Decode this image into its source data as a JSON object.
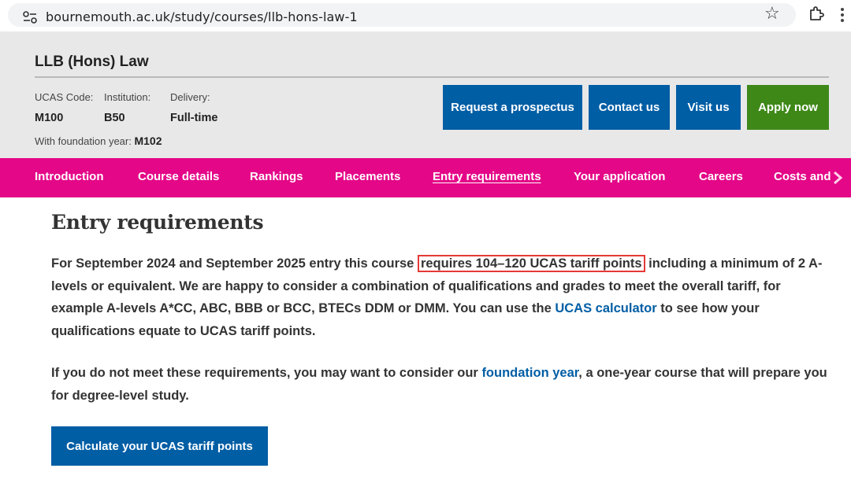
{
  "browser": {
    "url": "bournemouth.ac.uk/study/courses/llb-hons-law-1"
  },
  "course": {
    "title": "LLB (Hons) Law",
    "ucas_code_label": "UCAS Code:",
    "ucas_code_value": "M100",
    "institution_label": "Institution:",
    "institution_value": "B50",
    "delivery_label": "Delivery:",
    "delivery_value": "Full-time",
    "foundation_label": "With foundation year:",
    "foundation_value": "M102"
  },
  "actions": {
    "prospectus": "Request a prospectus",
    "contact": "Contact us",
    "visit": "Visit us",
    "apply": "Apply now"
  },
  "nav": {
    "items": [
      "Introduction",
      "Course details",
      "Rankings",
      "Placements",
      "Entry requirements",
      "Your application",
      "Careers",
      "Costs and"
    ],
    "active_index": 4
  },
  "content": {
    "title": "Entry requirements",
    "p1_a": "For September 2024 and September 2025 entry this course ",
    "p1_highlight": "requires 104–120 UCAS tariff points",
    "p1_b": " including a minimum of 2 A-levels or equivalent. We are happy to consider a combination of qualifications and grades to meet the overall tariff, for example A-levels A*CC, ABC, BBB or BCC, BTECs DDM or DMM. You can use the ",
    "p1_link": "UCAS calculator",
    "p1_c": " to see how your qualifications equate to UCAS tariff points.",
    "p2_a": "If you do not meet these requirements, you may want to consider our ",
    "p2_link": "foundation year",
    "p2_b": ", a one-year course that will prepare you for degree-level study.",
    "calc_button": "Calculate your UCAS tariff points"
  },
  "colors": {
    "nav_bg": "#e40788",
    "primary_blue": "#005ea5",
    "apply_green": "#3e8818",
    "highlight_red": "#e53935"
  },
  "icons": {
    "site_info": "site-info-icon",
    "bookmark": "star-icon",
    "extensions": "puzzle-icon",
    "menu": "more-vert-icon",
    "nav_next": "chevron-right-icon"
  }
}
